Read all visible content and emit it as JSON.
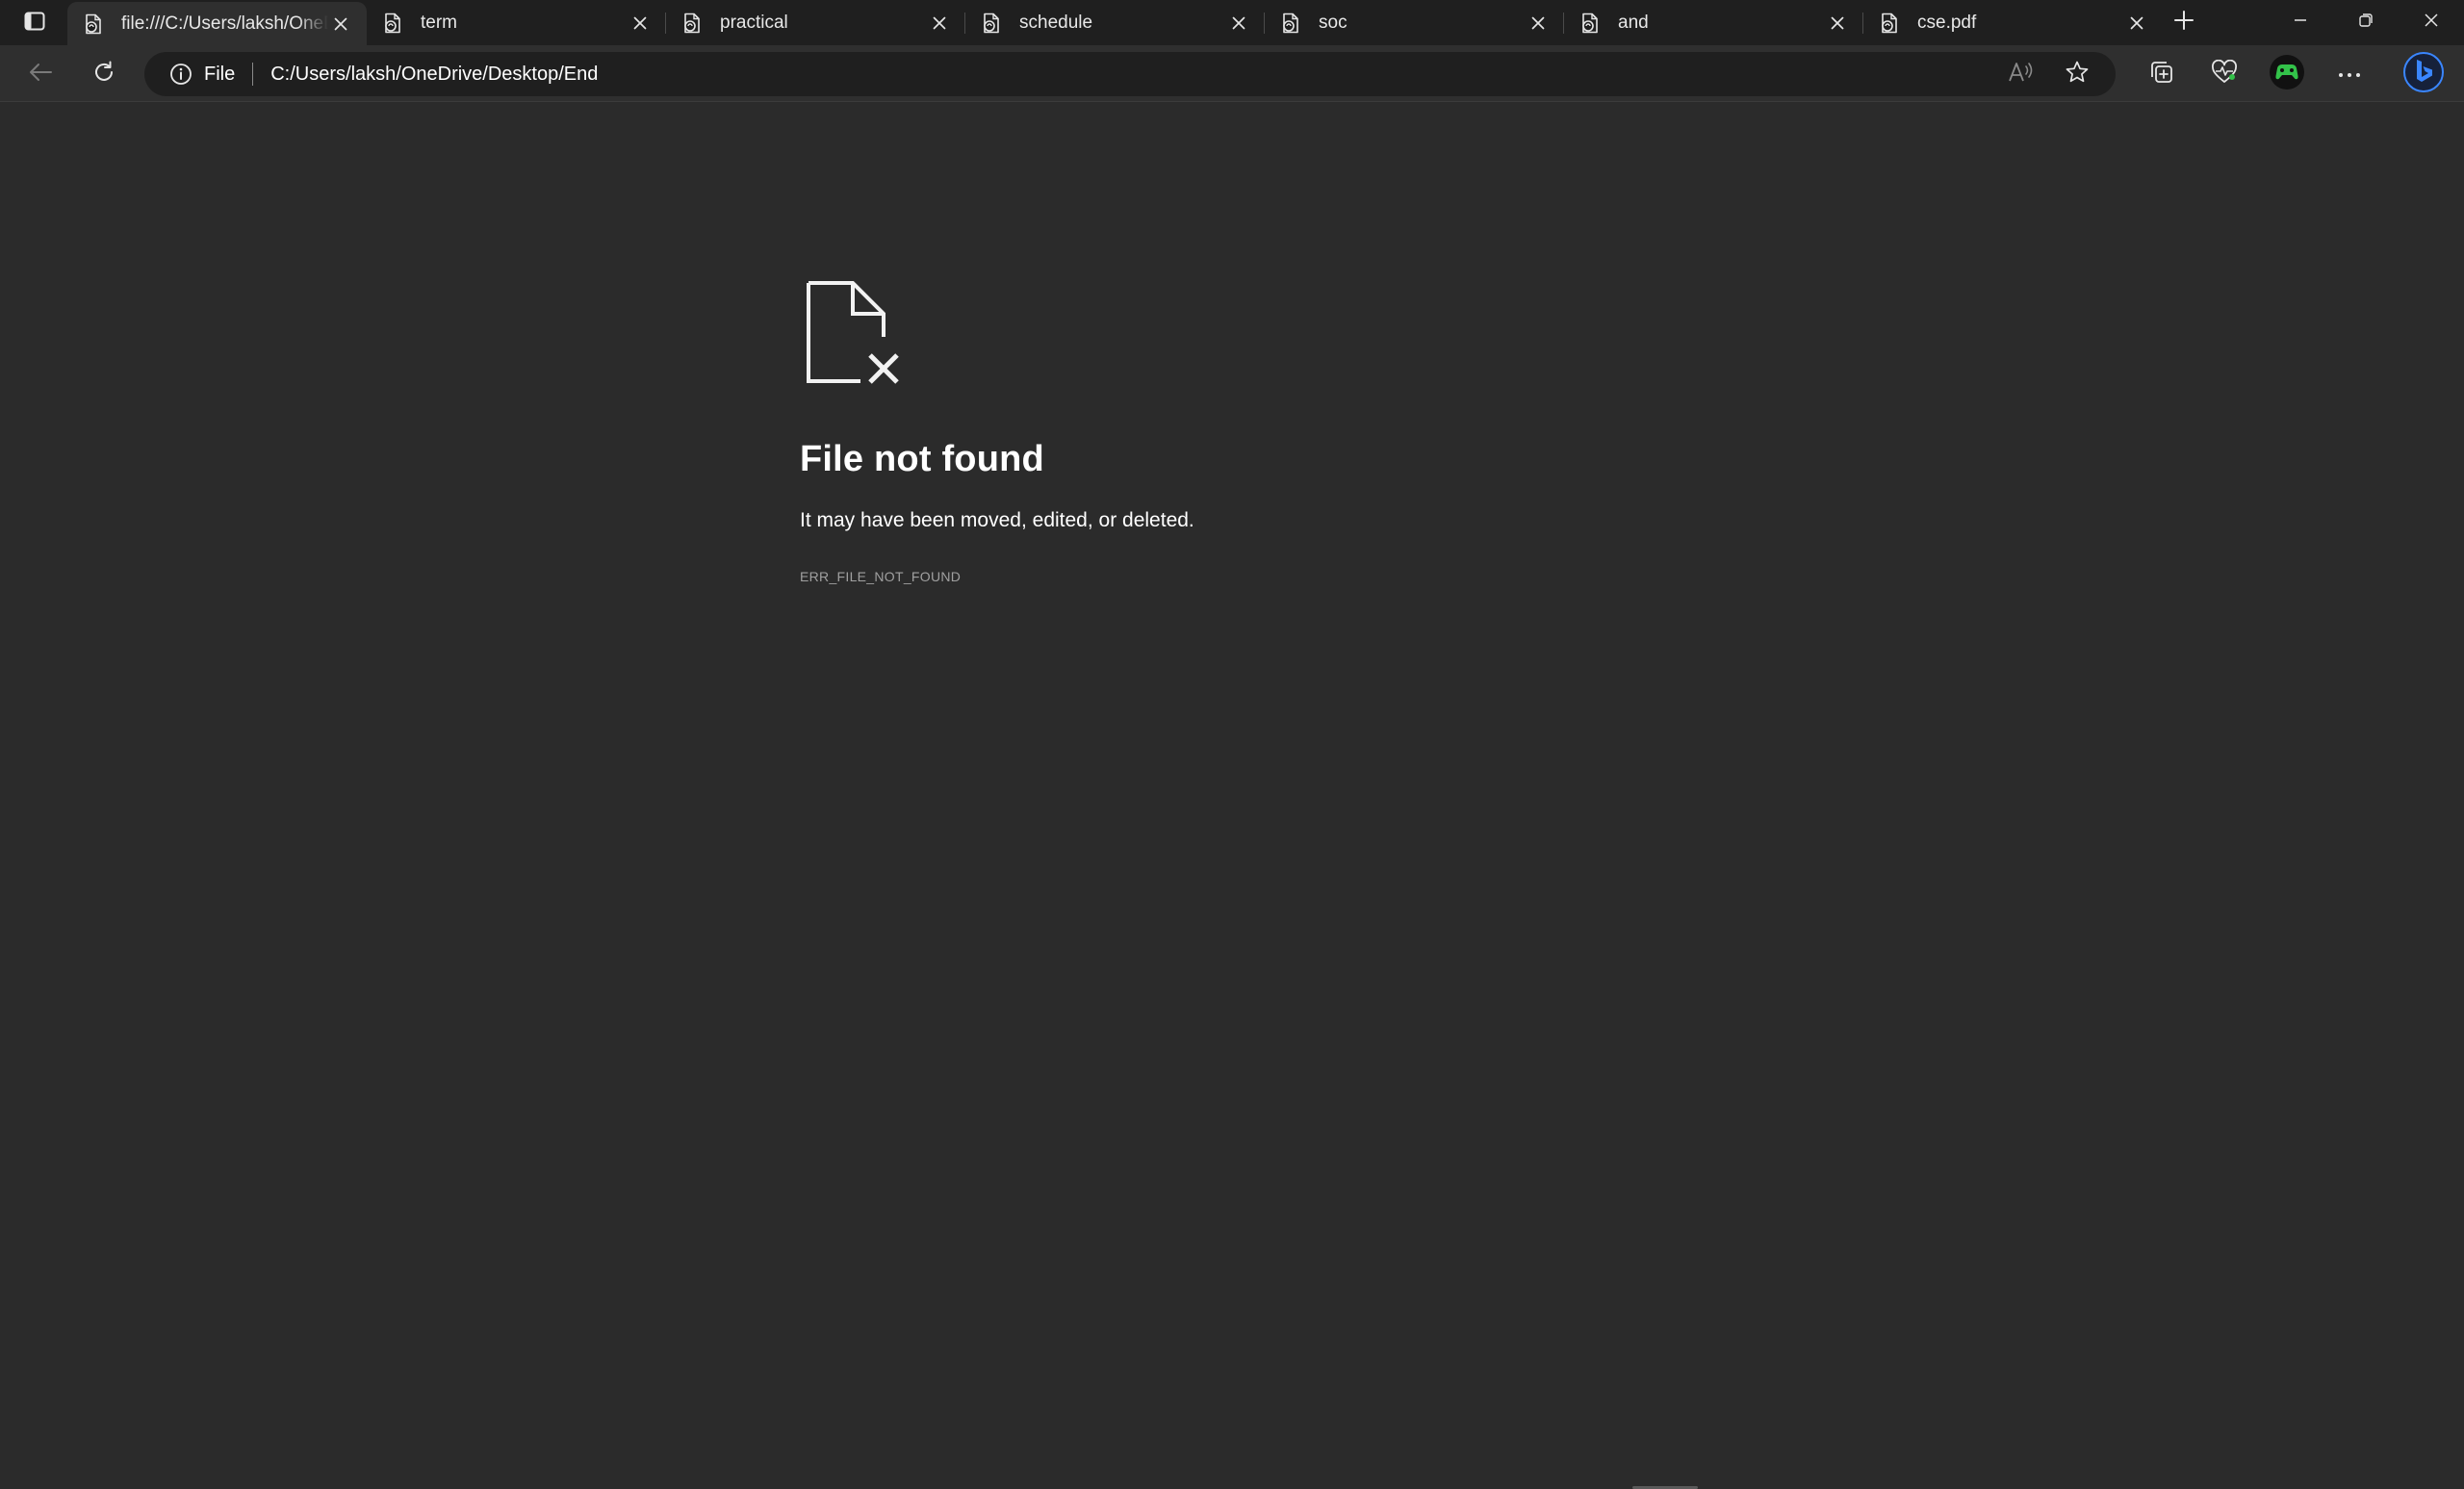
{
  "tabs": [
    {
      "title": "file:///C:/Users/laksh/OneDrive/Desktop/End",
      "active": true
    },
    {
      "title": "term",
      "active": false
    },
    {
      "title": "practical",
      "active": false
    },
    {
      "title": "schedule",
      "active": false
    },
    {
      "title": "soc",
      "active": false
    },
    {
      "title": "and",
      "active": false
    },
    {
      "title": "cse.pdf",
      "active": false
    }
  ],
  "toolbar": {
    "site_label": "File",
    "url": "C:/Users/laksh/OneDrive/Desktop/End"
  },
  "error": {
    "title": "File not found",
    "description": "It may have been moved, edited, or deleted.",
    "code": "ERR_FILE_NOT_FOUND"
  },
  "icons": {
    "tab_actions": "tab-actions-icon",
    "tab_favicon": "pdf-document-icon",
    "tab_close": "close-icon",
    "new_tab": "plus-icon",
    "back": "back-arrow-icon",
    "refresh": "refresh-icon",
    "site_info": "info-icon",
    "read_aloud": "read-aloud-icon",
    "favorite": "star-icon",
    "collections": "collections-icon",
    "performance": "heart-pulse-icon",
    "extension": "gamepad-icon",
    "more": "ellipsis-icon",
    "copilot": "bing-icon",
    "page_error": "file-missing-icon"
  },
  "colors": {
    "tabstrip_bg": "#1f1f1f",
    "toolbar_bg": "#2f2f2f",
    "page_bg": "#2b2b2b",
    "extension_green": "#33c24a",
    "bing_blue": "#3a86ff"
  }
}
